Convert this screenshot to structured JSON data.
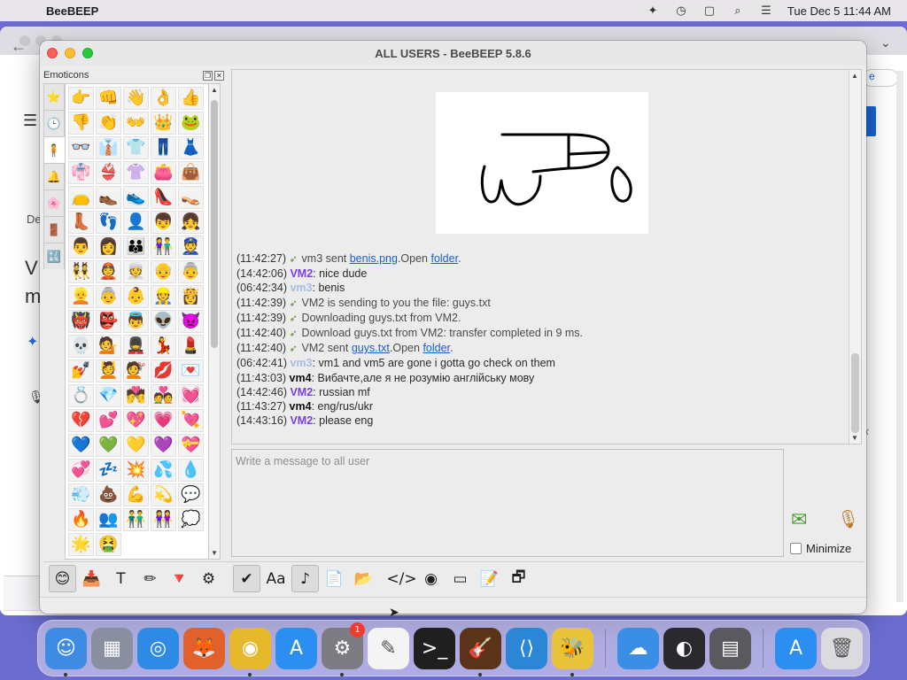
{
  "menubar": {
    "app_name": "BeeBEEP",
    "clock": "Tue Dec 5  11:44 AM",
    "icons": [
      "beebeep-tray-icon",
      "timer-icon",
      "screen-mirror-icon",
      "search-icon",
      "control-center-icon"
    ]
  },
  "background_window": {
    "partial_texts": {
      "e_pill": "e",
      "k_mark": "k",
      "de_text": "De",
      "v_text": "V",
      "m_text": "m"
    }
  },
  "window": {
    "title": "ALL USERS - BeeBEEP 5.8.6"
  },
  "emoticons": {
    "title": "Emoticons",
    "tabs": [
      "⭐",
      "🕒",
      "🧍",
      "🔔",
      "🌸",
      "🚪",
      "🔣"
    ],
    "cells": [
      "👉",
      "👊",
      "👋",
      "👌",
      "👍",
      "👎",
      "👏",
      "👐",
      "👑",
      "🐸",
      "👓",
      "👔",
      "👕",
      "👖",
      "👗",
      "👘",
      "👙",
      "👚",
      "👛",
      "👜",
      "👝",
      "👞",
      "👟",
      "👠",
      "👡",
      "👢",
      "👣",
      "👤",
      "👦",
      "👧",
      "👨",
      "👩",
      "👪",
      "👫",
      "👮",
      "👯",
      "👲",
      "👳",
      "👴",
      "👵",
      "👱",
      "👵",
      "👶",
      "👷",
      "👸",
      "👹",
      "👺",
      "👼",
      "👽",
      "👿",
      "💀",
      "💁",
      "💂",
      "💃",
      "💄",
      "💅",
      "💆",
      "💇",
      "💋",
      "💌",
      "💍",
      "💎",
      "💏",
      "💑",
      "💓",
      "💔",
      "💕",
      "💖",
      "💗",
      "💘",
      "💙",
      "💚",
      "💛",
      "💜",
      "💝",
      "💞",
      "💤",
      "💥",
      "💦",
      "💧",
      "💨",
      "💩",
      "💪",
      "💫",
      "💬",
      "🔥",
      "👥",
      "👬",
      "👭",
      "💭",
      "🌟",
      "🤮"
    ]
  },
  "chat": {
    "messages": [
      {
        "time": "(11:42:27)",
        "icon": "send-file-icon",
        "sender": "",
        "sender_class": "",
        "text": "vm3 sent ",
        "link": "benis.png",
        "text2": ".Open ",
        "link2": "folder",
        "text3": "."
      },
      {
        "time": "(14:42:06)",
        "icon": "",
        "sender": "VM2",
        "sender_class": "sender-vm2",
        "text": ": nice dude"
      },
      {
        "time": "(06:42:34)",
        "icon": "",
        "sender": "vm3",
        "sender_class": "sender-vm3",
        "text": ": benis"
      },
      {
        "time": "(11:42:39)",
        "icon": "send-file-icon",
        "sender": "",
        "sender_class": "",
        "text": "VM2 is sending to you the file: guys.txt"
      },
      {
        "time": "(11:42:39)",
        "icon": "send-file-icon",
        "sender": "",
        "sender_class": "",
        "text": "Downloading guys.txt from VM2."
      },
      {
        "time": "(11:42:40)",
        "icon": "send-file-icon",
        "sender": "",
        "sender_class": "",
        "text": "Download guys.txt from VM2: transfer completed in 9 ms."
      },
      {
        "time": "(11:42:40)",
        "icon": "send-file-icon",
        "sender": "",
        "sender_class": "",
        "text": "VM2 sent ",
        "link": "guys.txt",
        "text2": ".Open ",
        "link2": "folder",
        "text3": "."
      },
      {
        "time": "(06:42:41)",
        "icon": "",
        "sender": "vm3",
        "sender_class": "sender-vm3",
        "text": ": vm1 and vm5 are gone i gotta go check on them"
      },
      {
        "time": "(11:43:03)",
        "icon": "",
        "sender": "vm4",
        "sender_class": "sender-vm4",
        "text": ": Вибачте,але я не розумію англійську мову"
      },
      {
        "time": "(14:42:46)",
        "icon": "",
        "sender": "VM2",
        "sender_class": "sender-vm2",
        "text": ": russian mf"
      },
      {
        "time": "(11:43:27)",
        "icon": "",
        "sender": "vm4",
        "sender_class": "sender-vm4",
        "text": ": eng/rus/ukr"
      },
      {
        "time": "(14:43:16)",
        "icon": "",
        "sender": "VM2",
        "sender_class": "sender-vm2",
        "text": ": please eng"
      }
    ]
  },
  "input": {
    "placeholder": "Write a message to all user",
    "minimize_label": "Minimize"
  },
  "toolbar": {
    "buttons": [
      {
        "name": "emoticons-button",
        "glyph": "😊",
        "pressed": true
      },
      {
        "name": "send-file-button",
        "glyph": "📥",
        "pressed": false
      },
      {
        "name": "font-button",
        "glyph": "T",
        "pressed": false
      },
      {
        "name": "color-button",
        "glyph": "✏",
        "pressed": false
      },
      {
        "name": "filter-button",
        "glyph": "🔻",
        "pressed": false
      },
      {
        "name": "settings-button",
        "glyph": "⚙",
        "pressed": false
      },
      {
        "name": "spellcheck-button",
        "glyph": "✔",
        "pressed": true
      },
      {
        "name": "word-complete-button",
        "glyph": "Aa",
        "pressed": false
      },
      {
        "name": "sound-button",
        "glyph": "♪",
        "pressed": true
      },
      {
        "name": "save-chat-button",
        "glyph": "📄",
        "pressed": false
      },
      {
        "name": "send-folder-button",
        "glyph": "📂",
        "pressed": false
      },
      {
        "name": "html-button",
        "glyph": "</>",
        "pressed": false
      },
      {
        "name": "screenshot-button",
        "glyph": "◉",
        "pressed": false
      },
      {
        "name": "clear-button",
        "glyph": "▭",
        "pressed": false
      },
      {
        "name": "notes-button",
        "glyph": "📝",
        "pressed": false
      },
      {
        "name": "detach-button",
        "glyph": "🗗",
        "pressed": false
      }
    ]
  },
  "dock": {
    "apps": [
      {
        "name": "finder",
        "glyph": "☺",
        "color": "#3d8be3",
        "running": true,
        "badge": ""
      },
      {
        "name": "launchpad",
        "glyph": "▦",
        "color": "#8a8fa0",
        "running": false,
        "badge": ""
      },
      {
        "name": "safari",
        "glyph": "◎",
        "color": "#2f8ae6",
        "running": false,
        "badge": ""
      },
      {
        "name": "firefox",
        "glyph": "🦊",
        "color": "#e2612a",
        "running": false,
        "badge": ""
      },
      {
        "name": "chrome",
        "glyph": "◉",
        "color": "#e6b92c",
        "running": true,
        "badge": ""
      },
      {
        "name": "app-store",
        "glyph": "A",
        "color": "#2b8ef0",
        "running": false,
        "badge": ""
      },
      {
        "name": "system-settings",
        "glyph": "⚙",
        "color": "#7c7c82",
        "running": true,
        "badge": "1"
      },
      {
        "name": "textedit",
        "glyph": "✎",
        "color": "#f4f4f4",
        "running": false,
        "badge": ""
      },
      {
        "name": "terminal",
        "glyph": ">_",
        "color": "#1f1f1f",
        "running": false,
        "badge": ""
      },
      {
        "name": "garageband",
        "glyph": "🎸",
        "color": "#5a3318",
        "running": true,
        "badge": ""
      },
      {
        "name": "vscode",
        "glyph": "⟨⟩",
        "color": "#2b86d6",
        "running": false,
        "badge": ""
      },
      {
        "name": "beebeep",
        "glyph": "🐝",
        "color": "#e8c33a",
        "running": true,
        "badge": ""
      }
    ],
    "apps2": [
      {
        "name": "weather",
        "glyph": "☁",
        "color": "#3a8ee6",
        "running": false,
        "badge": ""
      },
      {
        "name": "obs",
        "glyph": "◐",
        "color": "#2a2a2e",
        "running": false,
        "badge": ""
      },
      {
        "name": "calculator",
        "glyph": "▤",
        "color": "#5a5a5e",
        "running": false,
        "badge": ""
      }
    ],
    "apps3": [
      {
        "name": "app-store-2",
        "glyph": "A",
        "color": "#2b8ef0",
        "running": false,
        "badge": ""
      },
      {
        "name": "trash",
        "glyph": "🗑",
        "color": "#dadadf",
        "running": false,
        "badge": ""
      }
    ]
  }
}
